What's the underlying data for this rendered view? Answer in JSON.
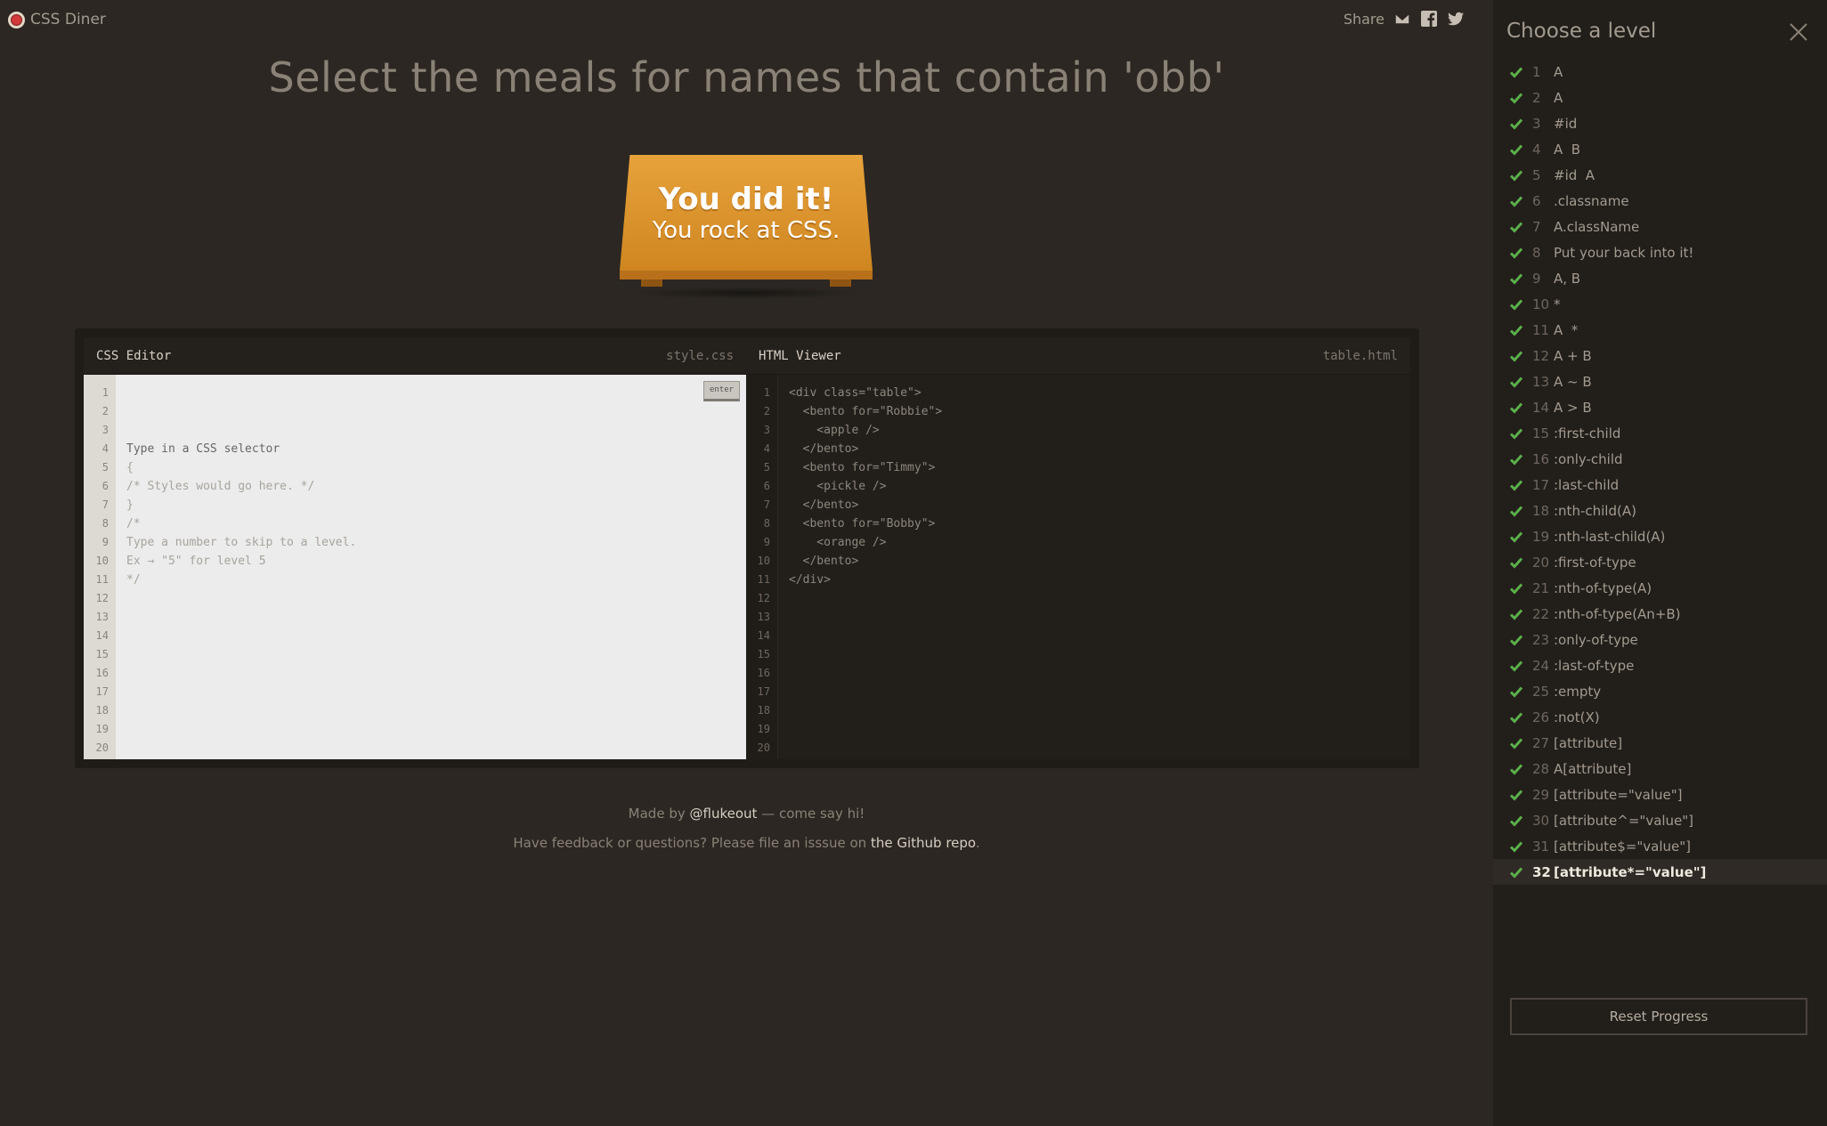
{
  "header": {
    "logo_text": "CSS Diner",
    "share_label": "Share",
    "share_icons": [
      "mail-icon",
      "facebook-icon",
      "twitter-icon"
    ]
  },
  "instruction": "Select the meals for names that contain 'obb'",
  "win": {
    "line1": "You did it!",
    "line2": "You rock at CSS."
  },
  "css_editor": {
    "title": "CSS Editor",
    "file": "style.css",
    "enter_label": "enter",
    "lines": [
      "Type in a CSS selector",
      "{",
      "/* Styles would go here. */",
      "}",
      "",
      "/*",
      "Type a number to skip to a level.",
      "Ex → \"5\" for level 5",
      "*/",
      "",
      "",
      "",
      "",
      "",
      "",
      "",
      "",
      "",
      "",
      ""
    ]
  },
  "html_viewer": {
    "title": "HTML Viewer",
    "file": "table.html",
    "lines": [
      "<div class=\"table\">",
      "  <bento for=\"Robbie\">",
      "    <apple />",
      "  </bento>",
      "  <bento for=\"Timmy\">",
      "    <pickle />",
      "  </bento>",
      "  <bento for=\"Bobby\">",
      "    <orange />",
      "  </bento>",
      "</div>",
      "",
      "",
      "",
      "",
      "",
      "",
      "",
      "",
      ""
    ]
  },
  "credits": {
    "line1_prefix": "Made by ",
    "line1_link": "@flukeout",
    "line1_suffix": " — come say hi!",
    "line2_prefix": "Have feedback or questions? Please file an isssue on ",
    "line2_link": "the Github repo",
    "line2_suffix": "."
  },
  "sidebar": {
    "title": "Choose a level",
    "levels": [
      {
        "num": "1",
        "name": "A"
      },
      {
        "num": "2",
        "name": "A"
      },
      {
        "num": "3",
        "name": "#id"
      },
      {
        "num": "4",
        "name": "A  B"
      },
      {
        "num": "5",
        "name": "#id  A"
      },
      {
        "num": "6",
        "name": ".classname"
      },
      {
        "num": "7",
        "name": "A.className"
      },
      {
        "num": "8",
        "name": "Put your back into it!"
      },
      {
        "num": "9",
        "name": "A, B"
      },
      {
        "num": "10",
        "name": "*"
      },
      {
        "num": "11",
        "name": "A  *"
      },
      {
        "num": "12",
        "name": "A + B"
      },
      {
        "num": "13",
        "name": "A ~ B"
      },
      {
        "num": "14",
        "name": "A > B"
      },
      {
        "num": "15",
        "name": ":first-child"
      },
      {
        "num": "16",
        "name": ":only-child"
      },
      {
        "num": "17",
        "name": ":last-child"
      },
      {
        "num": "18",
        "name": ":nth-child(A)"
      },
      {
        "num": "19",
        "name": ":nth-last-child(A)"
      },
      {
        "num": "20",
        "name": ":first-of-type"
      },
      {
        "num": "21",
        "name": ":nth-of-type(A)"
      },
      {
        "num": "22",
        "name": ":nth-of-type(An+B)"
      },
      {
        "num": "23",
        "name": ":only-of-type"
      },
      {
        "num": "24",
        "name": ":last-of-type"
      },
      {
        "num": "25",
        "name": ":empty"
      },
      {
        "num": "26",
        "name": ":not(X)"
      },
      {
        "num": "27",
        "name": "[attribute]"
      },
      {
        "num": "28",
        "name": "A[attribute]"
      },
      {
        "num": "29",
        "name": "[attribute=\"value\"]"
      },
      {
        "num": "30",
        "name": "[attribute^=\"value\"]"
      },
      {
        "num": "31",
        "name": "[attribute$=\"value\"]"
      },
      {
        "num": "32",
        "name": "[attribute*=\"value\"]"
      }
    ],
    "current_level": "32",
    "reset_label": "Reset Progress"
  }
}
